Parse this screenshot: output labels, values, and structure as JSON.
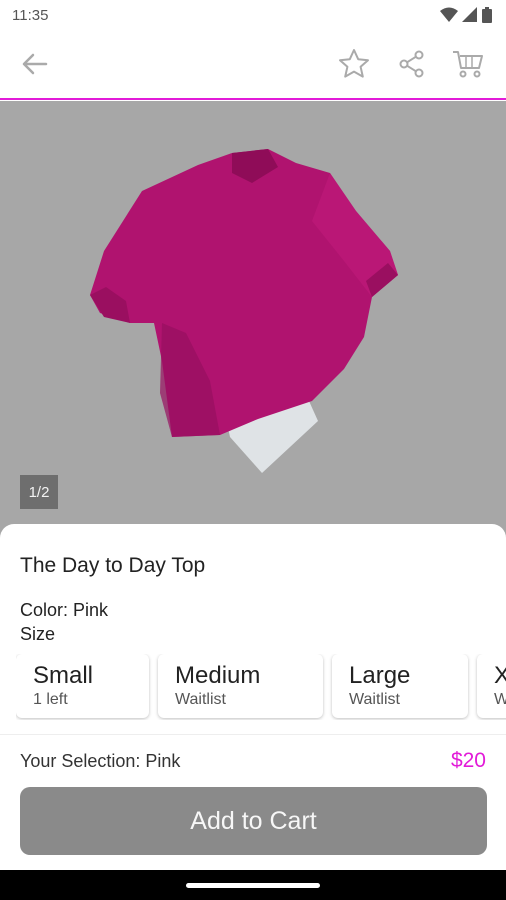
{
  "status_bar": {
    "time": "11:35"
  },
  "product": {
    "image_counter": "1/2",
    "title": "The Day to Day Top",
    "color_line": "Color: Pink",
    "size_label": "Size"
  },
  "sizes": [
    {
      "name": "Small",
      "status": "1 left"
    },
    {
      "name": "Medium",
      "status": "Waitlist"
    },
    {
      "name": "Large",
      "status": "Waitlist"
    },
    {
      "name": "X",
      "status": "W"
    }
  ],
  "footer": {
    "selection": "Your Selection: Pink",
    "price": "$20",
    "add_to_cart": "Add to Cart"
  },
  "colors": {
    "accent": "#e21bd8",
    "button": "#8a8a8a",
    "hero_bg": "#a7a7a7",
    "garment": "#b0136f"
  },
  "icons": [
    "wifi-icon",
    "signal-icon",
    "battery-icon",
    "back-arrow-icon",
    "star-icon",
    "share-icon",
    "cart-icon"
  ]
}
